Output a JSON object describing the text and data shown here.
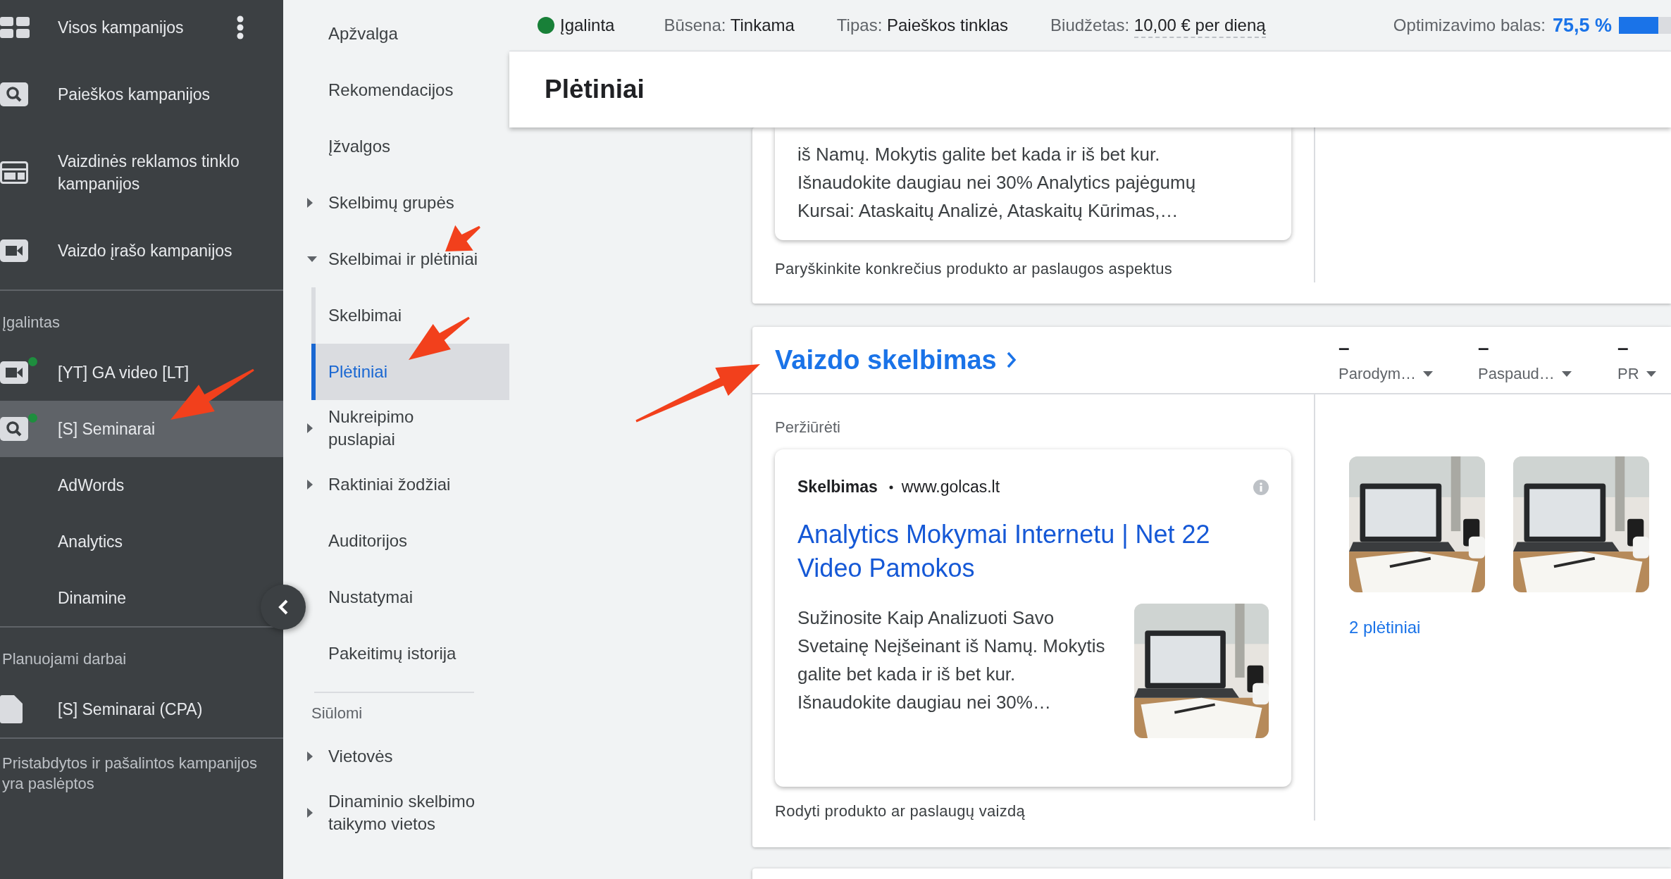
{
  "sidebar": {
    "sections": [
      {
        "items": [
          {
            "label": "Visos kampanijos",
            "kind": "grid",
            "selected": false
          },
          {
            "label": "Paieškos kampanijos",
            "kind": "search",
            "selected": false
          },
          {
            "label": "Vaizdinės reklamos tinklo kampanijos",
            "kind": "display",
            "selected": false
          },
          {
            "label": "Vaizdo įrašo kampanijos",
            "kind": "video",
            "selected": false
          }
        ]
      },
      {
        "heading": "Įgalintas",
        "items": [
          {
            "label": "[YT] GA video [LT]",
            "kind": "video",
            "selected": false,
            "enabled": true
          },
          {
            "label": "[S] Seminarai",
            "kind": "search",
            "selected": true,
            "enabled": true
          },
          {
            "label": "AdWords",
            "kind": "group",
            "selected": false,
            "enabled": false
          },
          {
            "label": "Analytics",
            "kind": "group",
            "selected": false,
            "enabled": false
          },
          {
            "label": "Dinamine",
            "kind": "group",
            "selected": false,
            "enabled": false
          }
        ]
      },
      {
        "heading": "Planuojami darbai",
        "items": [
          {
            "label": "[S] Seminarai (CPA)",
            "kind": "doc",
            "selected": false
          }
        ]
      },
      {
        "note": "Pristabdytos ir pašalintos kampanijos yra paslėptos"
      }
    ]
  },
  "nav": {
    "items": [
      {
        "label": "Apžvalga",
        "selected": false
      },
      {
        "label": "Rekomendacijos",
        "selected": false
      },
      {
        "label": "Įžvalgos",
        "selected": false
      },
      {
        "label": "Skelbimų grupės",
        "selected": false,
        "expanded": false
      },
      {
        "label": "Skelbimai ir plėtiniai",
        "selected": false,
        "expanded": true,
        "children": [
          {
            "label": "Skelbimai",
            "selected": false
          },
          {
            "label": "Plėtiniai",
            "selected": true
          }
        ]
      },
      {
        "label": "Nukreipimo puslapiai",
        "selected": false,
        "expanded": false
      },
      {
        "label": "Raktiniai žodžiai",
        "selected": false,
        "expanded": false
      },
      {
        "label": "Auditorijos",
        "selected": false
      },
      {
        "label": "Nustatymai",
        "selected": false
      },
      {
        "label": "Pakeitimų istorija",
        "selected": false
      }
    ],
    "suggested_heading": "Siūlomi",
    "suggested": [
      {
        "label": "Vietovės",
        "selected": false,
        "expanded": false
      },
      {
        "label": "Dinaminio skelbimo taikymo vietos",
        "selected": false,
        "expanded": false
      }
    ]
  },
  "status_bar": {
    "status": {
      "label": "Įgalinta",
      "color": "#188038"
    },
    "fields": [
      {
        "label": "Būsena:",
        "value": "Tinkama",
        "underlined": false
      },
      {
        "label": "Tipas:",
        "value": "Paieškos tinklas",
        "underlined": false
      },
      {
        "label": "Biudžetas:",
        "value": "10,00 € per dieną",
        "underlined": true
      }
    ],
    "score": {
      "label": "Optimizavimo balas:",
      "value": "75,5 %",
      "level": 0.755
    }
  },
  "page_title": "Plėtiniai",
  "cards": [
    {
      "description": "iš Namų. Mokytis galite bet kada ir iš bet kur. Išnaudokite daugiau nei 30% Analytics pajėgumų Kursai: Ataskaitų Analizė, Ataskaitų Kūrimas,…",
      "caption": "Paryškinkite konkrečius produkto ar paslaugos aspektus"
    },
    {
      "title": "Vaizdo skelbimas",
      "metrics": [
        {
          "value": "–",
          "label": "Parodym…"
        },
        {
          "value": "–",
          "label": "Paspaud…"
        },
        {
          "value": "–",
          "label": "PR"
        }
      ],
      "preview_label": "Peržiūrėti",
      "ad": {
        "badge": "Skelbimas",
        "url": "www.golcas.lt",
        "headline": "Analytics Mokymai Internetu | Net 22 Video Pamokos",
        "description": "Sužinosite Kaip Analizuoti Savo Svetainę Neįšeinant iš Namų. Mokytis galite bet kada ir iš bet kur. Išnaudokite daugiau nei 30%…",
        "image": {
          "kind": "picture"
        }
      },
      "caption": "Rodyti produkto ar paslaugų vaizdą",
      "thumbnails": [
        {
          "kind": "picture"
        },
        {
          "kind": "picture"
        }
      ],
      "extensions_link": "2 plėtiniai"
    }
  ]
}
